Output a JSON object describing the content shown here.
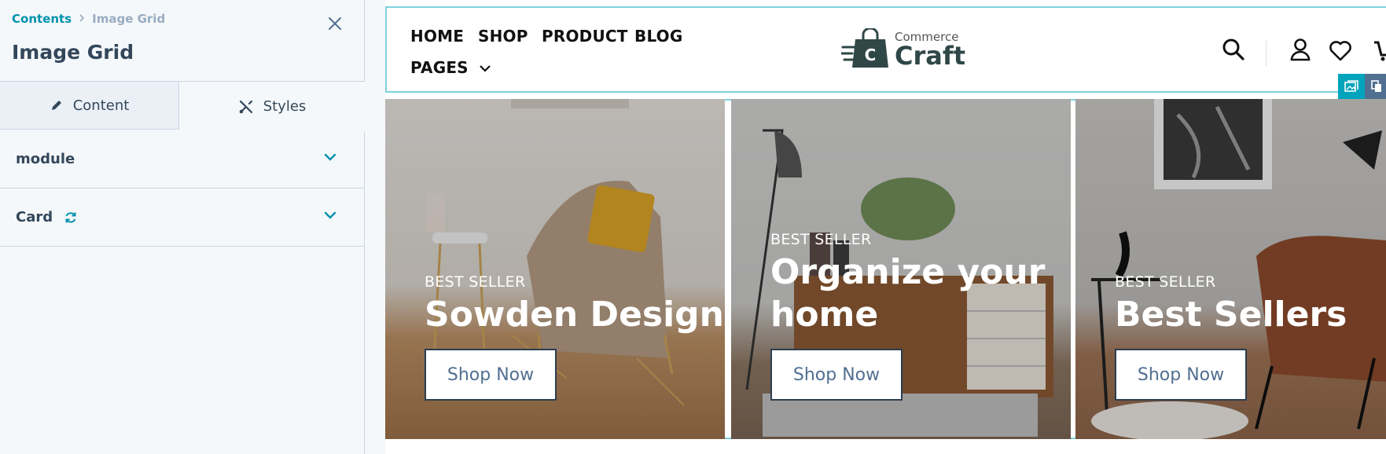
{
  "panel": {
    "breadcrumb": {
      "parent": "Contents",
      "current": "Image Grid"
    },
    "title": "Image Grid",
    "tabs": [
      {
        "label": "Content",
        "icon": "pencil-icon"
      },
      {
        "label": "Styles",
        "icon": "brush-icon"
      }
    ],
    "sections": [
      {
        "label": "module"
      },
      {
        "label": "Card"
      }
    ]
  },
  "site": {
    "nav": [
      "HOME",
      "SHOP",
      "PRODUCT",
      "BLOG",
      "PAGES"
    ],
    "logo": {
      "small": "Commerce",
      "big": "Craft",
      "mark": "C"
    }
  },
  "cards": [
    {
      "eyebrow": "BEST SELLER",
      "headline": "Sowden Design",
      "button": "Shop Now"
    },
    {
      "eyebrow": "BEST SELLER",
      "headline_line1": "Organize your",
      "headline_line2": "home",
      "button": "Shop Now"
    },
    {
      "eyebrow": "BEST SELLER",
      "headline": "Best Sellers",
      "button": "Shop Now"
    }
  ],
  "colors": {
    "accent": "#0091ae",
    "text": "#33475b",
    "muted": "#99acc2",
    "border": "#cbd6e2",
    "preview_outline": "#7fd1de"
  }
}
